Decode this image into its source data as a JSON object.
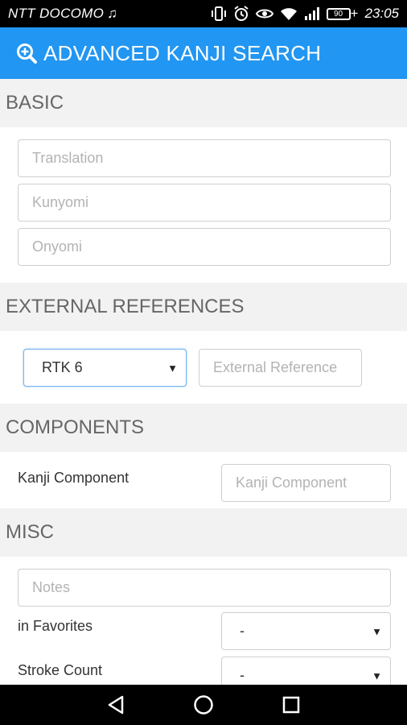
{
  "status_bar": {
    "carrier": "NTT DOCOMO",
    "battery_level": "90",
    "time": "23:05",
    "icons": [
      "music-note-icon",
      "vibrate-icon",
      "alarm-icon",
      "eye-icon",
      "wifi-icon",
      "signal-icon",
      "battery-icon"
    ]
  },
  "app_bar": {
    "icon": "search-plus-icon",
    "title": "ADVANCED KANJI SEARCH",
    "color": "#2196f3"
  },
  "sections": {
    "basic": {
      "header": "BASIC",
      "translation_placeholder": "Translation",
      "kunyomi_placeholder": "Kunyomi",
      "onyomi_placeholder": "Onyomi"
    },
    "external_references": {
      "header": "EXTERNAL REFERENCES",
      "reference_select_value": "RTK 6",
      "reference_placeholder": "External Reference"
    },
    "components": {
      "header": "COMPONENTS",
      "component_label": "Kanji Component",
      "component_placeholder": "Kanji Component"
    },
    "misc": {
      "header": "MISC",
      "notes_placeholder": "Notes",
      "favorites_label": "in Favorites",
      "favorites_select_value": "-",
      "stroke_count_label": "Stroke Count",
      "stroke_count_select_value": "-"
    }
  },
  "nav_bar": {
    "buttons": [
      "back-icon",
      "home-icon",
      "recents-icon"
    ]
  }
}
